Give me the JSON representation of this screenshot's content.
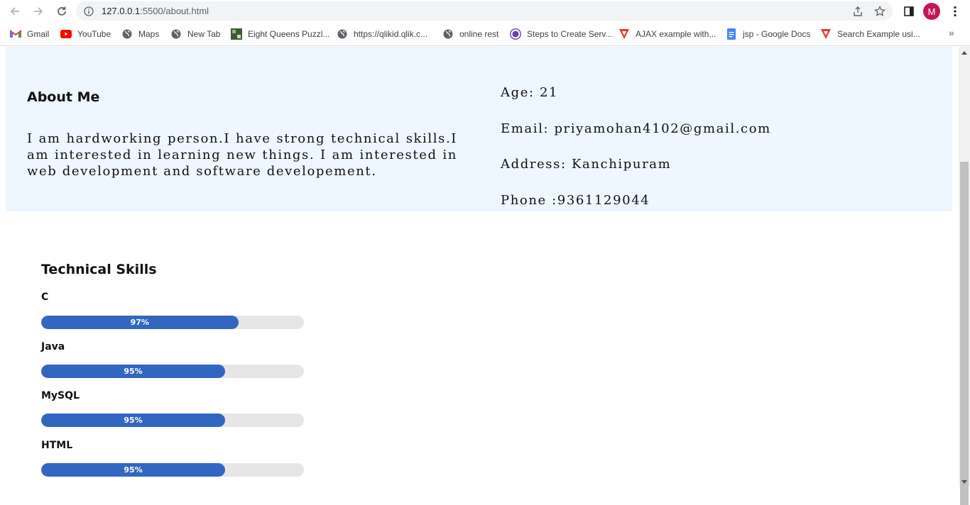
{
  "browser": {
    "url_host": "127.0.0.1",
    "url_path": ":5500/about.html",
    "profile_initial": "M"
  },
  "bookmarks": [
    {
      "label": "Gmail",
      "icon": "gmail-icon"
    },
    {
      "label": "YouTube",
      "icon": "youtube-icon"
    },
    {
      "label": "Maps",
      "icon": "globe-icon"
    },
    {
      "label": "New Tab",
      "icon": "globe-icon"
    },
    {
      "label": "Eight Queens Puzzl...",
      "icon": "image-icon"
    },
    {
      "label": "https://qlikid.qlik.c...",
      "icon": "globe-icon"
    },
    {
      "label": "online rest",
      "icon": "globe-icon"
    },
    {
      "label": "Steps to Create Serv...",
      "icon": "site-icon"
    },
    {
      "label": "AJAX example with...",
      "icon": "red-v-icon"
    },
    {
      "label": "jsp - Google Docs",
      "icon": "docs-icon"
    },
    {
      "label": "Search Example usi...",
      "icon": "red-v-icon"
    }
  ],
  "about": {
    "heading": "About Me",
    "text": "I am hardworking person.I have strong technical skills.I am interested in learning new things. I am interested in web development and software developement."
  },
  "info": {
    "age": "Age: 21",
    "email": "Email: priyamohan4102@gmail.com",
    "address": "Address: Kanchipuram",
    "phone": "Phone :9361129044"
  },
  "skills": {
    "heading": "Technical Skills",
    "items": [
      {
        "name": "C",
        "percent_label": "97%",
        "fill_fraction": 0.75
      },
      {
        "name": "Java",
        "percent_label": "95%",
        "fill_fraction": 0.7
      },
      {
        "name": "MySQL",
        "percent_label": "95%",
        "fill_fraction": 0.7
      },
      {
        "name": "HTML",
        "percent_label": "95%",
        "fill_fraction": 0.7
      }
    ]
  },
  "colors": {
    "about_band": "#eef6ff",
    "bar_fill": "#3366c0",
    "bar_track": "#e6e6e6",
    "avatar": "#c2185b"
  }
}
